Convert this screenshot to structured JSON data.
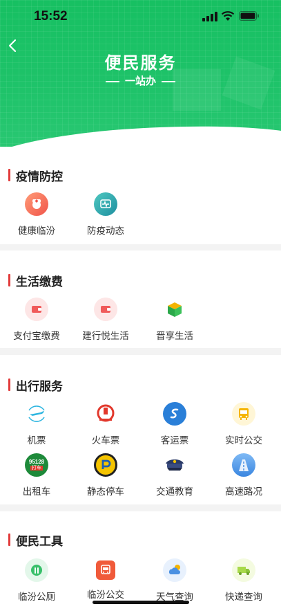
{
  "status": {
    "time": "15:52"
  },
  "header": {
    "title": "便民服务",
    "subtitle": "一站办"
  },
  "sections": [
    {
      "title": "疫情防控",
      "items": [
        {
          "label": "健康临汾"
        },
        {
          "label": "防疫动态"
        }
      ]
    },
    {
      "title": "生活缴费",
      "items": [
        {
          "label": "支付宝缴费"
        },
        {
          "label": "建行悦生活"
        },
        {
          "label": "晋享生活"
        }
      ]
    },
    {
      "title": "出行服务",
      "items": [
        {
          "label": "机票"
        },
        {
          "label": "火车票"
        },
        {
          "label": "客运票"
        },
        {
          "label": "实时公交"
        },
        {
          "label": "出租车",
          "badge_top": "95128",
          "badge_bottom": "打车"
        },
        {
          "label": "静态停车"
        },
        {
          "label": "交通教育"
        },
        {
          "label": "高速路况"
        }
      ]
    },
    {
      "title": "便民工具",
      "items": [
        {
          "label": "临汾公厕"
        },
        {
          "label": "临汾公交"
        },
        {
          "label": "天气查询"
        },
        {
          "label": "快递查询"
        }
      ]
    }
  ],
  "colors": {
    "brand_green": "#1fc36a",
    "section_accent": "#e23b3b"
  }
}
